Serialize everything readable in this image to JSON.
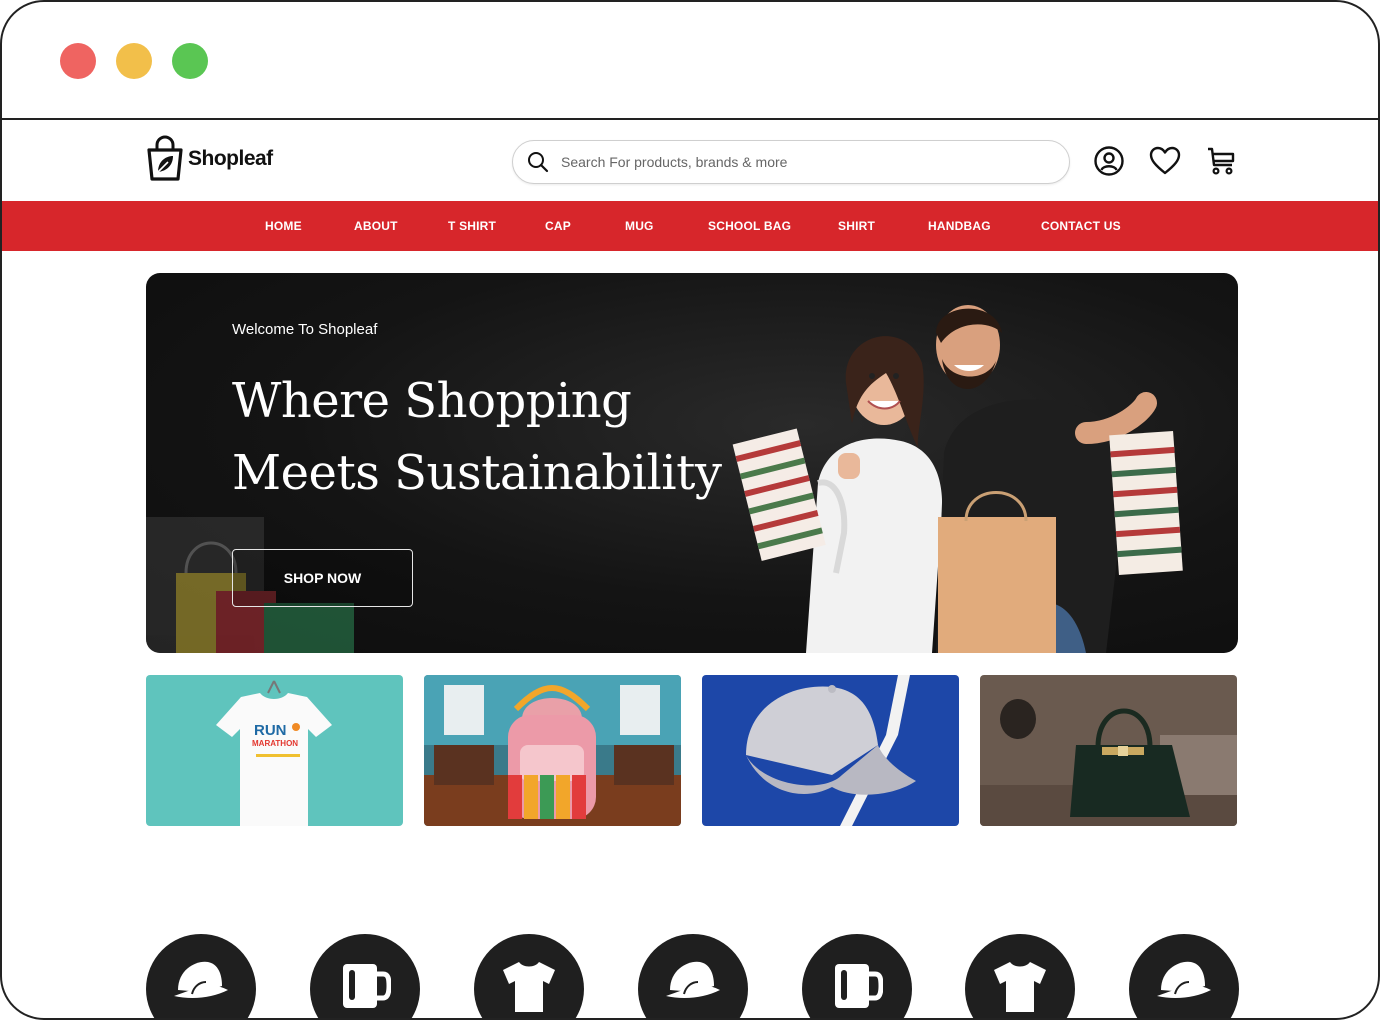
{
  "window": {
    "controls": [
      "close",
      "minimize",
      "maximize"
    ]
  },
  "header": {
    "logo_text": "Shopleaf",
    "search_placeholder": "Search For products, brands & more",
    "icons": [
      "account-icon",
      "heart-icon",
      "cart-icon"
    ]
  },
  "nav": {
    "items": [
      "HOME",
      "ABOUT",
      "T SHIRT",
      "CAP",
      "MUG",
      "SCHOOL BAG",
      "SHIRT",
      "HANDBAG",
      "CONTACT US"
    ]
  },
  "hero": {
    "welcome": "Welcome To Shopleaf",
    "headline_line1": "Where Shopping",
    "headline_line2": "Meets Sustainability",
    "button_label": "SHOP NOW"
  },
  "categories": [
    {
      "name": "T Shirt",
      "print_line1": "RUN",
      "print_line2": "MARATHON"
    },
    {
      "name": "School Bag"
    },
    {
      "name": "Cap"
    },
    {
      "name": "Handbag"
    }
  ],
  "category_circles": [
    "cap-icon",
    "mug-icon",
    "tshirt-icon",
    "cap-icon",
    "mug-icon",
    "tshirt-icon",
    "cap-icon"
  ],
  "colors": {
    "nav_red": "#d7262b",
    "hero_bg": "#141414",
    "tile_tshirt_bg": "#5fc4bd",
    "tile_cap_bg": "#1d47a8",
    "circle_bg": "#1f1f1f"
  }
}
